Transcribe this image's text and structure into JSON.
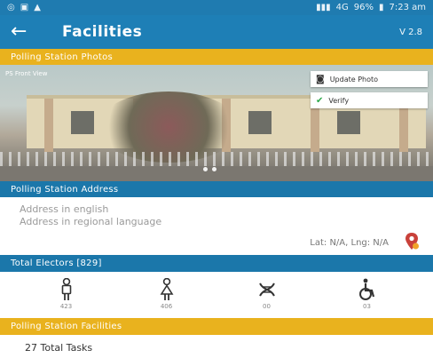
{
  "status_bar": {
    "left_icons": [
      "whatsapp-icon",
      "media-icon",
      "notification-icon"
    ],
    "network": "4G",
    "battery": "96%",
    "time": "7:23 am"
  },
  "app_bar": {
    "title": "Facilities",
    "version": "V 2.8"
  },
  "photo_section": {
    "title": "Polling Station Photos",
    "photo_label": "PS Front View",
    "update_label": "Update Photo",
    "verify_label": "Verify",
    "carousel_pages": 2,
    "carousel_active": 0
  },
  "address_section": {
    "title": "Polling Station Address",
    "address_english": "Address in english",
    "address_regional": "Address in regional language",
    "latlng": "Lat: N/A, Lng: N/A"
  },
  "electors_section": {
    "title": "Total Electors [829]",
    "items": [
      {
        "icon": "male-icon",
        "count": "423"
      },
      {
        "icon": "female-icon",
        "count": "406"
      },
      {
        "icon": "third-gender-icon",
        "count": "00"
      },
      {
        "icon": "wheelchair-icon",
        "count": "03"
      }
    ]
  },
  "facilities_section": {
    "title": "Polling Station Facilities",
    "tasks": "27 Total Tasks"
  },
  "colors": {
    "primary_blue": "#1e7fb6",
    "section_yellow": "#e9b21e",
    "verify_green": "#2da84a"
  }
}
